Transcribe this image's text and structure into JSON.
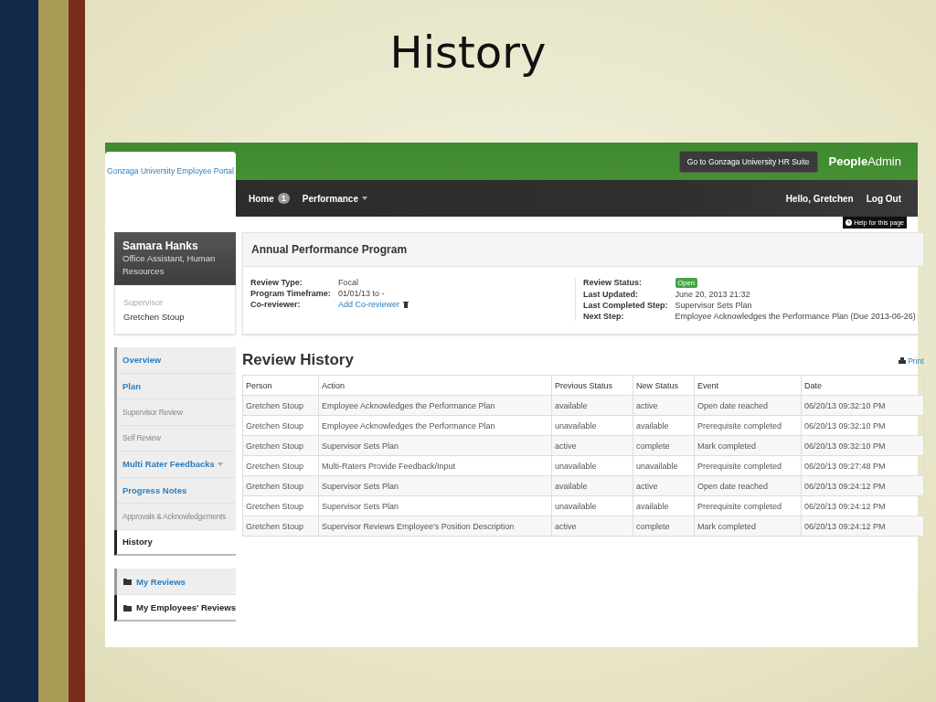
{
  "slide_title": "History",
  "portal": {
    "tab": "Gonzaga University Employee Portal",
    "hr_suite_button": "Go to Gonzaga University HR Suite",
    "brand": {
      "bold": "People",
      "plain": "Admin"
    },
    "nav": [
      {
        "label": "Home",
        "badge": "1",
        "dropdown": false
      },
      {
        "label": "Performance",
        "dropdown": true
      }
    ],
    "greeting": "Hello, Gretchen",
    "logout": "Log Out",
    "help": "Help for this page"
  },
  "profile": {
    "name": "Samara Hanks",
    "title": "Office Assistant, Human Resources",
    "supervisor_label": "Supervisor",
    "supervisor": "Gretchen Stoup"
  },
  "program": {
    "title": "Annual Performance Program",
    "left": [
      {
        "label": "Review Type:",
        "value": "Focal",
        "kind": "text"
      },
      {
        "label": "Program Timeframe:",
        "value": "01/01/13 to -",
        "kind": "text"
      },
      {
        "label": "Co-reviewer:",
        "value": "Add Co-reviewer",
        "kind": "link"
      }
    ],
    "right": [
      {
        "label": "Review Status:",
        "value": "Open",
        "kind": "badge"
      },
      {
        "label": "Last Updated:",
        "value": "June 20, 2013 21:32",
        "kind": "text"
      },
      {
        "label": "Last Completed Step:",
        "value": "Supervisor Sets Plan",
        "kind": "text"
      },
      {
        "label": "Next Step:",
        "value": "Employee Acknowledges the Performance Plan (Due 2013-06-26)",
        "kind": "text"
      }
    ]
  },
  "sidebar": {
    "items": [
      {
        "label": "Overview",
        "selected": false,
        "disabled": false,
        "dropdown": false
      },
      {
        "label": "Plan",
        "selected": false,
        "disabled": false,
        "dropdown": false
      },
      {
        "label": "Supervisor Review",
        "selected": false,
        "disabled": true,
        "dropdown": false
      },
      {
        "label": "Self Review",
        "selected": false,
        "disabled": true,
        "dropdown": false
      },
      {
        "label": "Multi Rater Feedbacks",
        "selected": false,
        "disabled": false,
        "dropdown": true
      },
      {
        "label": "Progress Notes",
        "selected": false,
        "disabled": false,
        "dropdown": false
      },
      {
        "label": "Approvals & Acknowledgements",
        "selected": false,
        "disabled": true,
        "dropdown": false
      },
      {
        "label": "History",
        "selected": true,
        "disabled": false,
        "dropdown": false
      }
    ],
    "reviews": [
      {
        "label": "My Reviews",
        "selected": false
      },
      {
        "label": "My Employees' Reviews",
        "selected": true
      }
    ]
  },
  "history": {
    "title": "Review History",
    "print": "Print",
    "columns": [
      "Person",
      "Action",
      "Previous Status",
      "New Status",
      "Event",
      "Date"
    ],
    "rows": [
      [
        "Gretchen Stoup",
        "Employee Acknowledges the Performance Plan",
        "available",
        "active",
        "Open date reached",
        "06/20/13 09:32:10 PM"
      ],
      [
        "Gretchen Stoup",
        "Employee Acknowledges the Performance Plan",
        "unavailable",
        "available",
        "Prerequisite completed",
        "06/20/13 09:32:10 PM"
      ],
      [
        "Gretchen Stoup",
        "Supervisor Sets Plan",
        "active",
        "complete",
        "Mark completed",
        "06/20/13 09:32:10 PM"
      ],
      [
        "Gretchen Stoup",
        "Multi-Raters Provide Feedback/Input",
        "unavailable",
        "unavailable",
        "Prerequisite completed",
        "06/20/13 09:27:48 PM"
      ],
      [
        "Gretchen Stoup",
        "Supervisor Sets Plan",
        "available",
        "active",
        "Open date reached",
        "06/20/13 09:24:12 PM"
      ],
      [
        "Gretchen Stoup",
        "Supervisor Sets Plan",
        "unavailable",
        "available",
        "Prerequisite completed",
        "06/20/13 09:24:12 PM"
      ],
      [
        "Gretchen Stoup",
        "Supervisor Reviews Employee's Position Description",
        "active",
        "complete",
        "Mark completed",
        "06/20/13 09:24:12 PM"
      ]
    ]
  }
}
